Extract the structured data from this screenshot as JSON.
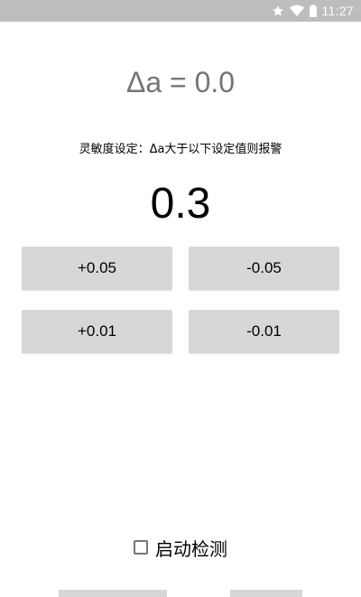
{
  "status_bar": {
    "time": "11:27",
    "icons": [
      "star-icon",
      "wifi-icon",
      "battery-icon"
    ]
  },
  "display": {
    "delta_text": "Δa = 0.0"
  },
  "sensitivity": {
    "label": "灵敏度设定：Δa大于以下设定值则报警",
    "value": "0.3"
  },
  "buttons": {
    "plus_005": "+0.05",
    "minus_005": "-0.05",
    "plus_001": "+0.01",
    "minus_001": "-0.01"
  },
  "detection": {
    "label": "启动检测",
    "checked": false
  },
  "colors": {
    "status_bar": "#bdbdbd",
    "button_bg": "#d6d7d7",
    "delta_text": "#757575"
  }
}
